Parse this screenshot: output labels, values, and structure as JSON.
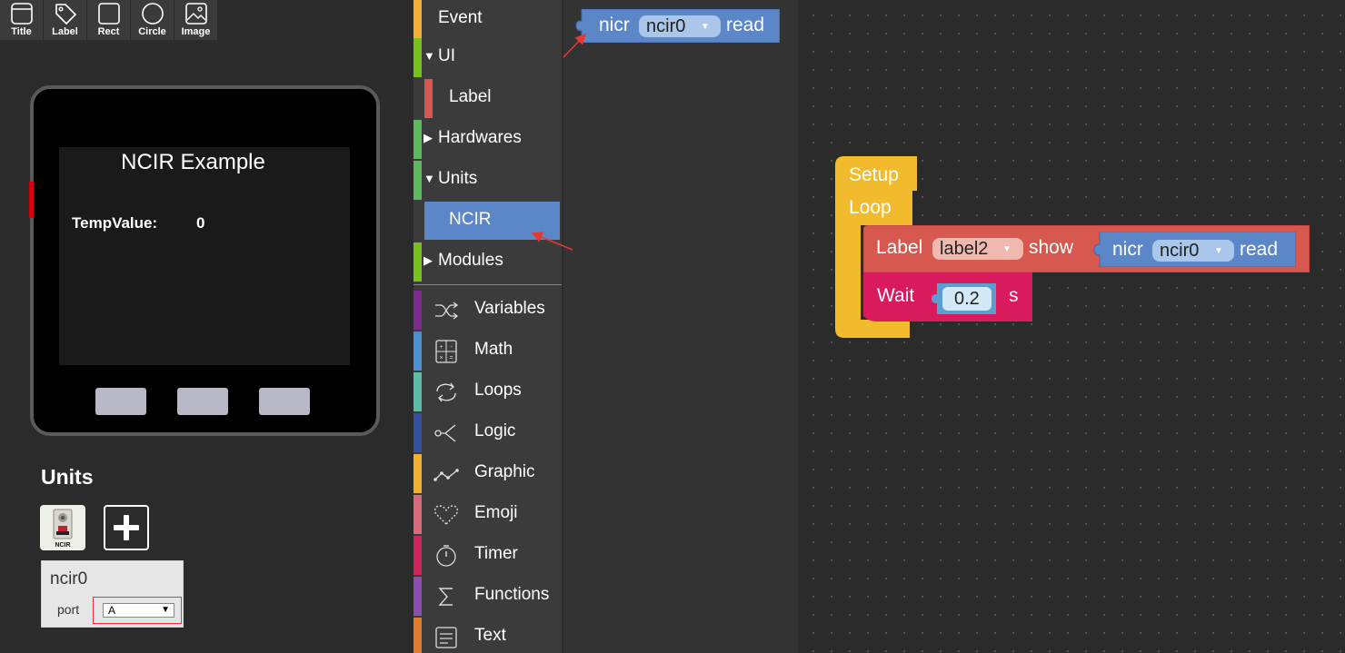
{
  "toolbar": {
    "tools": [
      {
        "label": "Title",
        "icon": "title-icon"
      },
      {
        "label": "Label",
        "icon": "label-tag-icon"
      },
      {
        "label": "Rect",
        "icon": "rect-icon"
      },
      {
        "label": "Circle",
        "icon": "circle-icon"
      },
      {
        "label": "Image",
        "icon": "image-icon"
      }
    ]
  },
  "device": {
    "screen_title": "NCIR Example",
    "temp_label": "TempValue:",
    "temp_value": "0"
  },
  "units": {
    "title": "Units",
    "unit_icon_text": "NCIR",
    "card": {
      "name": "ncir0",
      "port_label": "port",
      "port_value": "A"
    }
  },
  "menu": {
    "categories": [
      {
        "label": "Event",
        "color": "#f2b134"
      },
      {
        "label": "UI",
        "color": "#76c21b",
        "expanded": true
      },
      {
        "label": "Label",
        "color": "#d6584f"
      },
      {
        "label": "Hardwares",
        "color": "#5cb85c",
        "expanded": false
      },
      {
        "label": "Units",
        "color": "#5cb85c",
        "expanded": true
      },
      {
        "label": "NCIR",
        "color": "#5b86c8",
        "selected": true
      },
      {
        "label": "Modules",
        "color": "#76c21b",
        "expanded": false
      },
      {
        "label": "Variables",
        "color": "#7c2c8c",
        "icon": "shuffle-icon"
      },
      {
        "label": "Math",
        "color": "#4a90d0",
        "icon": "calculator-icon"
      },
      {
        "label": "Loops",
        "color": "#5bbcaa",
        "icon": "loop-arrows-icon"
      },
      {
        "label": "Logic",
        "color": "#3450a0",
        "icon": "branch-icon"
      },
      {
        "label": "Graphic",
        "color": "#f0b030",
        "icon": "graph-line-icon"
      },
      {
        "label": "Emoji",
        "color": "#d96a7a",
        "icon": "heart-icon"
      },
      {
        "label": "Timer",
        "color": "#d0245c",
        "icon": "stopwatch-icon"
      },
      {
        "label": "Functions",
        "color": "#8c4fb0",
        "icon": "sigma-icon"
      },
      {
        "label": "Text",
        "color": "#e07b2e",
        "icon": "document-icon"
      }
    ]
  },
  "flyout": {
    "block": {
      "prefix": "nicr",
      "dropdown": "ncir0",
      "suffix": "read"
    }
  },
  "workspace": {
    "setup_label": "Setup",
    "loop_label": "Loop",
    "label_block": {
      "prefix": "Label",
      "dropdown": "label2",
      "action": "show"
    },
    "nested_block": {
      "prefix": "nicr",
      "dropdown": "ncir0",
      "suffix": "read"
    },
    "wait_block": {
      "prefix": "Wait",
      "value": "0.2",
      "unit": "s"
    }
  },
  "colors": {
    "event": "#f2b134",
    "label": "#d6584f",
    "unit": "#5b86c8",
    "timer": "#d91a5d",
    "loop_frame": "#f2bb2d",
    "annotation_arrow": "#e53935"
  }
}
